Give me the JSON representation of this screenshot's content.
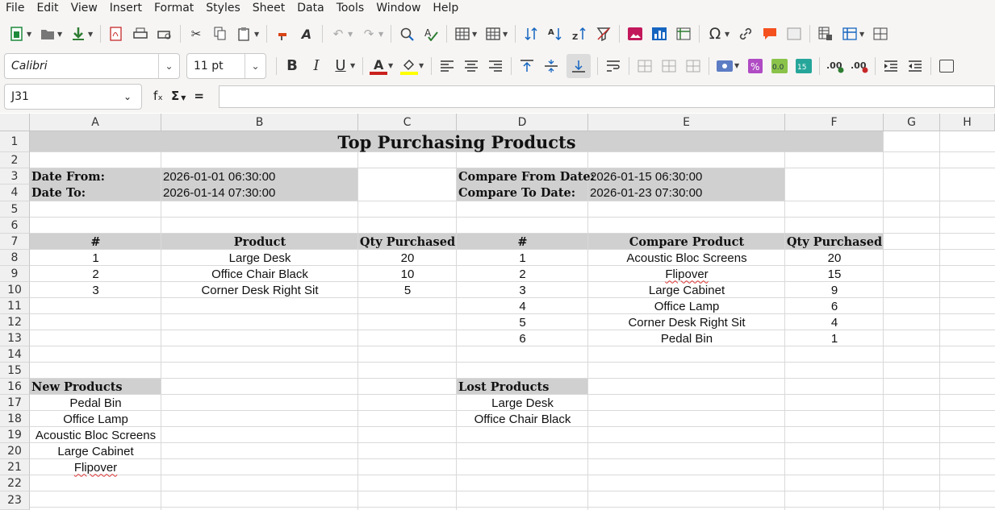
{
  "menu": [
    "File",
    "Edit",
    "View",
    "Insert",
    "Format",
    "Styles",
    "Sheet",
    "Data",
    "Tools",
    "Window",
    "Help"
  ],
  "toolbar": {
    "font_name": "Calibri",
    "font_size": "11 pt"
  },
  "formula_bar": {
    "cell_ref": "J31",
    "func_symbol": "fₓ",
    "sum_symbol": "Σ",
    "eq_symbol": "=",
    "value": ""
  },
  "columns": [
    "A",
    "B",
    "C",
    "D",
    "E",
    "F",
    "G",
    "H"
  ],
  "rows": [
    "1",
    "2",
    "3",
    "4",
    "5",
    "6",
    "7",
    "8",
    "9",
    "10",
    "11",
    "12",
    "13",
    "14",
    "15",
    "16",
    "17",
    "18",
    "19",
    "20",
    "21",
    "22",
    "23"
  ],
  "sheet": {
    "title": "Top Purchasing Products",
    "date_from_label": "Date From:",
    "date_from": "2026-01-01 06:30:00",
    "date_to_label": "Date To:",
    "date_to": "2026-01-14 07:30:00",
    "compare_from_label": "Compare From Date:",
    "compare_from": "2026-01-15 06:30:00",
    "compare_to_label": "Compare To Date:",
    "compare_to": "2026-01-23 07:30:00",
    "hdr_num": "#",
    "hdr_product": "Product",
    "hdr_qty": "Qty Purchased",
    "hdr_num2": "#",
    "hdr_compare_product": "Compare Product",
    "hdr_qty2": "Qty Purchased",
    "products": [
      {
        "n": "1",
        "name": "Large Desk",
        "qty": "20"
      },
      {
        "n": "2",
        "name": "Office Chair Black",
        "qty": "10"
      },
      {
        "n": "3",
        "name": "Corner Desk Right Sit",
        "qty": "5"
      }
    ],
    "compare_products": [
      {
        "n": "1",
        "name": "Acoustic Bloc Screens",
        "qty": "20"
      },
      {
        "n": "2",
        "name": "Flipover",
        "qty": "15"
      },
      {
        "n": "3",
        "name": "Large Cabinet",
        "qty": "9"
      },
      {
        "n": "4",
        "name": "Office Lamp",
        "qty": "6"
      },
      {
        "n": "5",
        "name": "Corner Desk Right Sit",
        "qty": "4"
      },
      {
        "n": "6",
        "name": "Pedal Bin",
        "qty": "1"
      }
    ],
    "new_products_label": "New Products",
    "new_products": [
      "Pedal Bin",
      "Office Lamp",
      "Acoustic Bloc Screens",
      "Large Cabinet",
      "Flipover"
    ],
    "lost_products_label": "Lost Products",
    "lost_products": [
      "Large Desk",
      "Office Chair Black"
    ]
  }
}
